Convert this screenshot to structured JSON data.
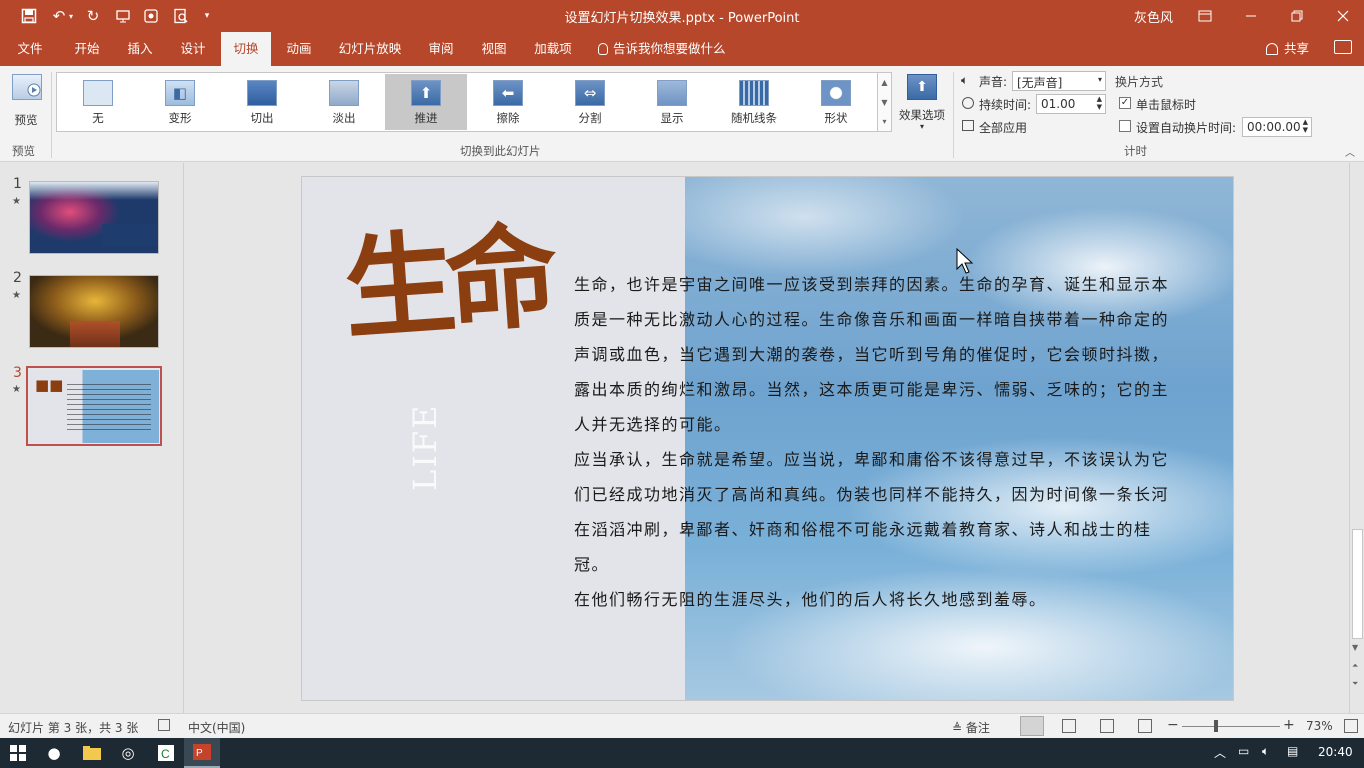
{
  "titlebar": {
    "document_title": "设置幻灯片切换效果.pptx - PowerPoint",
    "user_name": "灰色风",
    "qat_icons": [
      "save-icon",
      "undo-icon",
      "redo-icon",
      "start-from-beginning-icon",
      "touch-mode-icon",
      "print-preview-icon",
      "customize-qat-icon"
    ]
  },
  "tabs": [
    {
      "label": "文件"
    },
    {
      "label": "开始"
    },
    {
      "label": "插入"
    },
    {
      "label": "设计"
    },
    {
      "label": "切换",
      "active": true
    },
    {
      "label": "动画"
    },
    {
      "label": "幻灯片放映"
    },
    {
      "label": "审阅"
    },
    {
      "label": "视图"
    },
    {
      "label": "加载项"
    }
  ],
  "tell_me": "告诉我你想要做什么",
  "share_label": "共享",
  "ribbon": {
    "preview_label": "预览",
    "preview_group": "预览",
    "transitions_group": "切换到此幻灯片",
    "transitions": [
      {
        "label": "无",
        "icon": "none-transition-icon"
      },
      {
        "label": "变形",
        "icon": "morph-transition-icon"
      },
      {
        "label": "切出",
        "icon": "cut-transition-icon"
      },
      {
        "label": "淡出",
        "icon": "fade-transition-icon"
      },
      {
        "label": "推进",
        "icon": "push-transition-icon",
        "selected": true
      },
      {
        "label": "擦除",
        "icon": "wipe-transition-icon"
      },
      {
        "label": "分割",
        "icon": "split-transition-icon"
      },
      {
        "label": "显示",
        "icon": "reveal-transition-icon"
      },
      {
        "label": "随机线条",
        "icon": "random-bars-transition-icon"
      },
      {
        "label": "形状",
        "icon": "shape-transition-icon"
      }
    ],
    "effect_options_label": "效果选项",
    "sound_label": "声音:",
    "sound_value": "[无声音]",
    "duration_label": "持续时间:",
    "duration_value": "01.00",
    "apply_all_label": "全部应用",
    "advance_title": "换片方式",
    "on_click_label": "单击鼠标时",
    "on_click_checked": true,
    "auto_after_label": "设置自动换片时间:",
    "auto_after_checked": false,
    "auto_after_value": "00:00.00",
    "timing_group": "计时"
  },
  "slides_pane": [
    {
      "number": "1",
      "star": "★",
      "thumb": "forest-pink"
    },
    {
      "number": "2",
      "star": "★",
      "thumb": "autumn-trees"
    },
    {
      "number": "3",
      "star": "★",
      "thumb": "life-sky",
      "selected": true
    }
  ],
  "slide": {
    "title": "生命",
    "subtitle": "LIFE",
    "paragraphs": [
      "生命，也许是宇宙之间唯一应该受到崇拜的因素。生命的孕育、诞生和显示本质是一种无比激动人心的过程。生命像音乐和画面一样暗自挟带着一种命定的声调或血色，当它遇到大潮的袭卷，当它听到号角的催促时，它会顿时抖擞，露出本质的绚烂和激昂。当然，这本质更可能是卑污、懦弱、乏味的；它的主人并无选择的可能。",
      "应当承认，生命就是希望。应当说，卑鄙和庸俗不该得意过早，不该误认为它们已经成功地消灭了高尚和真纯。伪装也同样不能持久，因为时间像一条长河在滔滔冲刷，卑鄙者、奸商和俗棍不可能永远戴着教育家、诗人和战士的桂冠。",
      "在他们畅行无阻的生涯尽头，他们的后人将长久地感到羞辱。"
    ]
  },
  "status": {
    "slide_info": "幻灯片 第 3 张，共 3 张",
    "language": "中文(中国)",
    "notes_label": "备注",
    "zoom": "73%"
  },
  "taskbar": {
    "time": "20:40"
  },
  "colors": {
    "accent": "#b7472a",
    "title_brown": "#8b3e10"
  }
}
